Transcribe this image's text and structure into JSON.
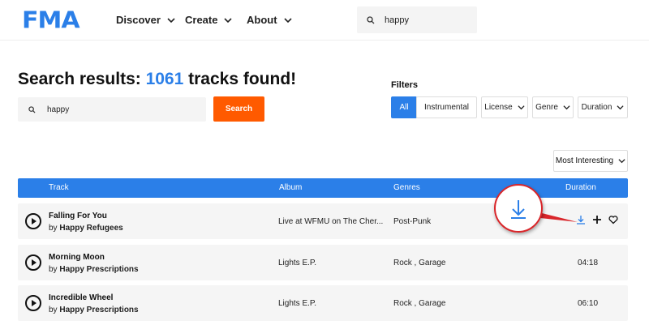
{
  "header": {
    "logo": "FMA",
    "nav": [
      {
        "label": "Discover"
      },
      {
        "label": "Create"
      },
      {
        "label": "About"
      }
    ],
    "search_value": "happy"
  },
  "results": {
    "prefix": "Search results: ",
    "count": "1061",
    "suffix": " tracks found!",
    "search_value": "happy",
    "search_button": "Search"
  },
  "filters": {
    "label": "Filters",
    "items": [
      {
        "label": "All",
        "active": true
      },
      {
        "label": "Instrumental"
      },
      {
        "label": "License"
      },
      {
        "label": "Genre"
      },
      {
        "label": "Duration"
      }
    ]
  },
  "sort": {
    "selected": "Most Interesting"
  },
  "table": {
    "columns": {
      "track": "Track",
      "album": "Album",
      "genres": "Genres",
      "duration": "Duration"
    },
    "rows": [
      {
        "title": "Falling For You",
        "artist_prefix": "by ",
        "artist": "Happy Refugees",
        "album": "Live at WFMU on The Cher...",
        "genres": "Post-Punk",
        "duration": ""
      },
      {
        "title": "Morning Moon",
        "artist_prefix": "by ",
        "artist": "Happy Prescriptions",
        "album": "Lights E.P.",
        "genres": "Rock , Garage",
        "duration": "04:18"
      },
      {
        "title": "Incredible Wheel",
        "artist_prefix": "by ",
        "artist": "Happy Prescriptions",
        "album": "Lights E.P.",
        "genres": "Rock , Garage",
        "duration": "06:10"
      }
    ]
  },
  "colors": {
    "brand": "#2b7fe8",
    "accent": "#ff5a00",
    "annotation": "#d9262b"
  },
  "icons": [
    "search-icon",
    "chevron-down-icon",
    "play-icon",
    "download-icon",
    "plus-icon",
    "heart-icon"
  ]
}
